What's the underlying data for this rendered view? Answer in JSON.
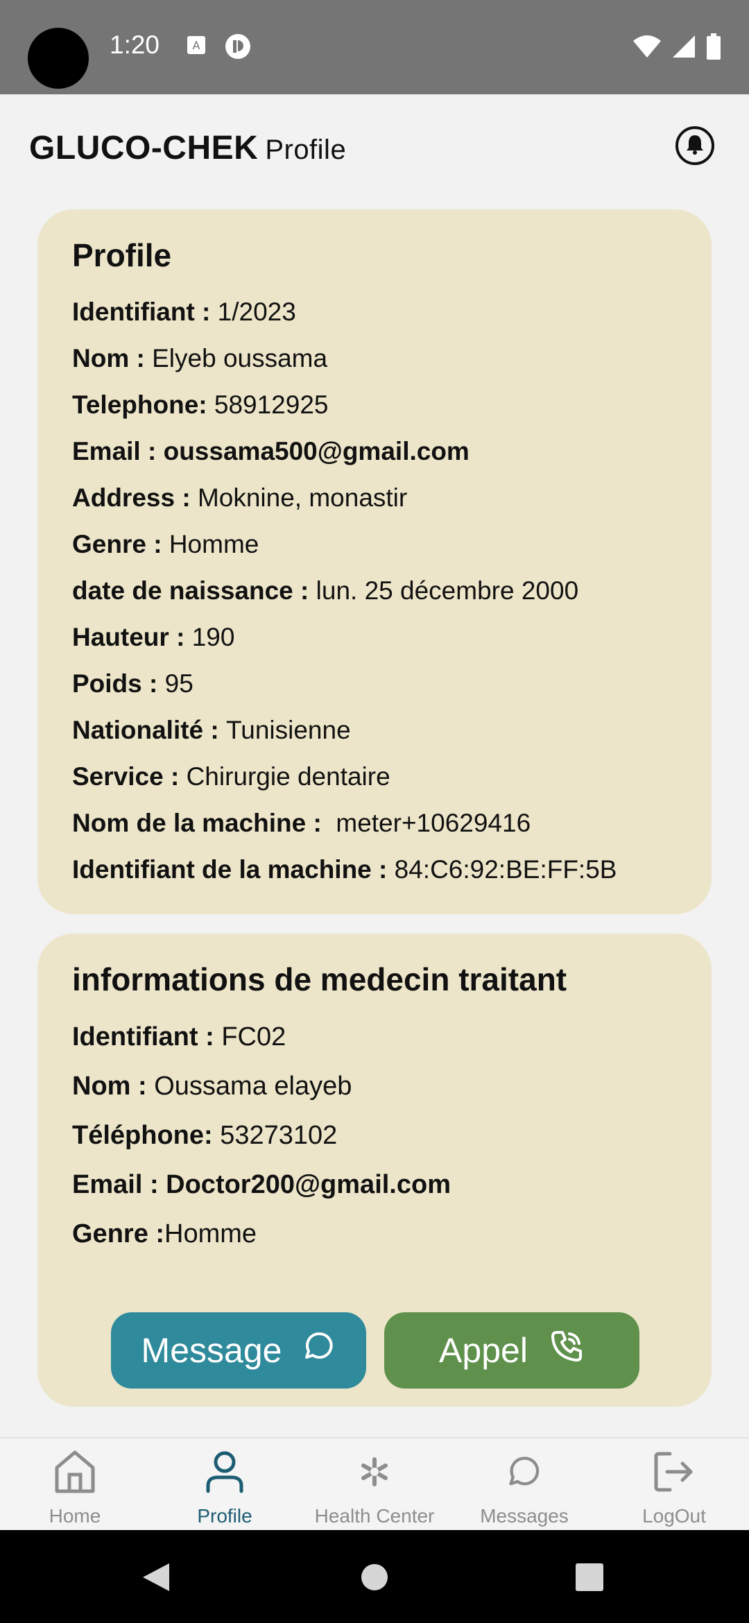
{
  "status_bar": {
    "time": "1:20"
  },
  "header": {
    "brand": "GLUCO-CHEK",
    "subtitle": "Profile"
  },
  "profile_card": {
    "title": "Profile",
    "rows": [
      {
        "label": "Identifiant : ",
        "value": "1/2023"
      },
      {
        "label": "Nom : ",
        "value": "Elyeb oussama"
      },
      {
        "label": "Telephone: ",
        "value": "58912925"
      },
      {
        "label": "Email : ",
        "value": "oussama500@gmail.com"
      },
      {
        "label": "Address : ",
        "value": "Moknine, monastir"
      },
      {
        "label": "Genre : ",
        "value": "Homme"
      },
      {
        "label": "date de naissance : ",
        "value": "lun. 25 décembre 2000"
      },
      {
        "label": "Hauteur : ",
        "value": "190"
      },
      {
        "label": "Poids : ",
        "value": "95"
      },
      {
        "label": "Nationalité : ",
        "value": "Tunisienne"
      },
      {
        "label": "Service : ",
        "value": "Chirurgie dentaire"
      },
      {
        "label": "Nom de la machine : ",
        "value": " meter+10629416"
      },
      {
        "label": "Identifiant de la machine : ",
        "value": "84:C6:92:BE:FF:5B"
      }
    ]
  },
  "doctor_card": {
    "title": "informations de medecin traitant",
    "rows": [
      {
        "label": "Identifiant : ",
        "value": "FC02"
      },
      {
        "label": "Nom : ",
        "value": "Oussama elayeb"
      },
      {
        "label": "Téléphone: ",
        "value": "53273102"
      },
      {
        "label": "Email : ",
        "value": "Doctor200@gmail.com"
      },
      {
        "label": "Genre :",
        "value": "Homme"
      }
    ],
    "message_button": "Message",
    "call_button": "Appel"
  },
  "bottom_nav": {
    "items": [
      {
        "label": "Home",
        "icon": "home-icon"
      },
      {
        "label": "Profile",
        "icon": "person-icon"
      },
      {
        "label": "Health Center",
        "icon": "medical-icon"
      },
      {
        "label": "Messages",
        "icon": "chat-icon"
      },
      {
        "label": "LogOut",
        "icon": "logout-icon"
      }
    ],
    "active": "Profile"
  },
  "colors": {
    "card_bg": "#ece5c9",
    "message_btn": "#2f8a9b",
    "call_btn": "#5f914d",
    "active_nav": "#1d5d74"
  }
}
